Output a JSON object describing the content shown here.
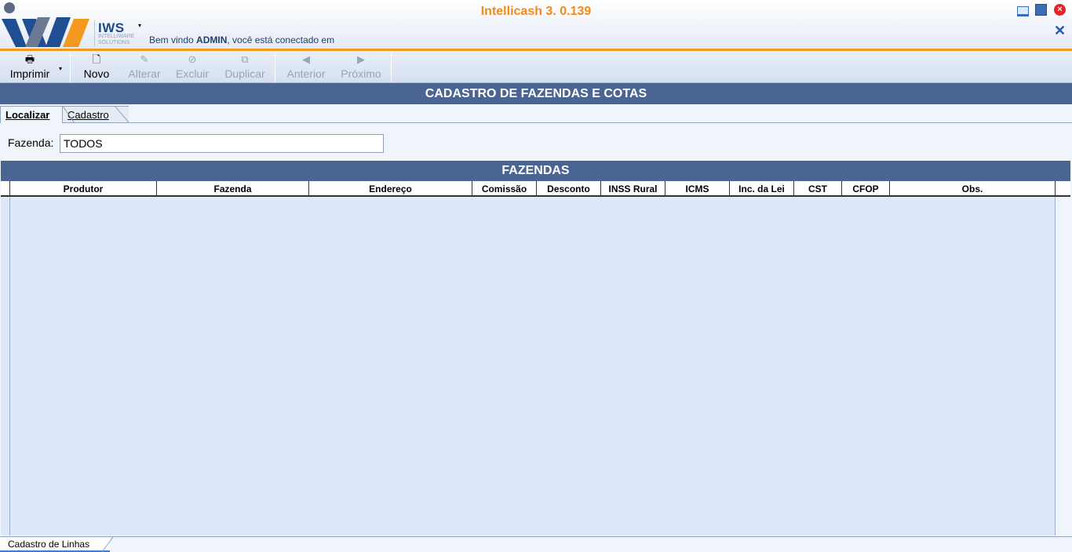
{
  "app": {
    "title": "Intellicash 3. 0.139",
    "brand": "IWS",
    "brand_sub": "INTELLIWARE SOLUTIONS",
    "welcome_prefix": "Bem vindo ",
    "welcome_user": "ADMIN",
    "welcome_suffix": ", você está conectado em"
  },
  "toolbar": {
    "print_label": "Imprimir",
    "new_label": "Novo",
    "edit_label": "Alterar",
    "delete_label": "Excluir",
    "duplicate_label": "Duplicar",
    "prev_label": "Anterior",
    "next_label": "Próximo"
  },
  "page": {
    "title": "CADASTRO DE FAZENDAS E COTAS"
  },
  "tabs": [
    {
      "label": "Localizar",
      "active": true
    },
    {
      "label": "Cadastro",
      "active": false
    }
  ],
  "filter": {
    "label": "Fazenda:",
    "value": "TODOS"
  },
  "grid": {
    "title": "FAZENDAS",
    "columns": [
      "Produtor",
      "Fazenda",
      "Endereço",
      "Comissão",
      "Desconto",
      "INSS Rural",
      "ICMS",
      "Inc. da Lei",
      "CST",
      "CFOP",
      "Obs."
    ],
    "rows": []
  },
  "bottom": {
    "tab_label": "Cadastro de Linhas"
  },
  "colors": {
    "accent": "#f28a1c",
    "bar": "#4a6592",
    "grid_bg": "#dfe8fa"
  }
}
